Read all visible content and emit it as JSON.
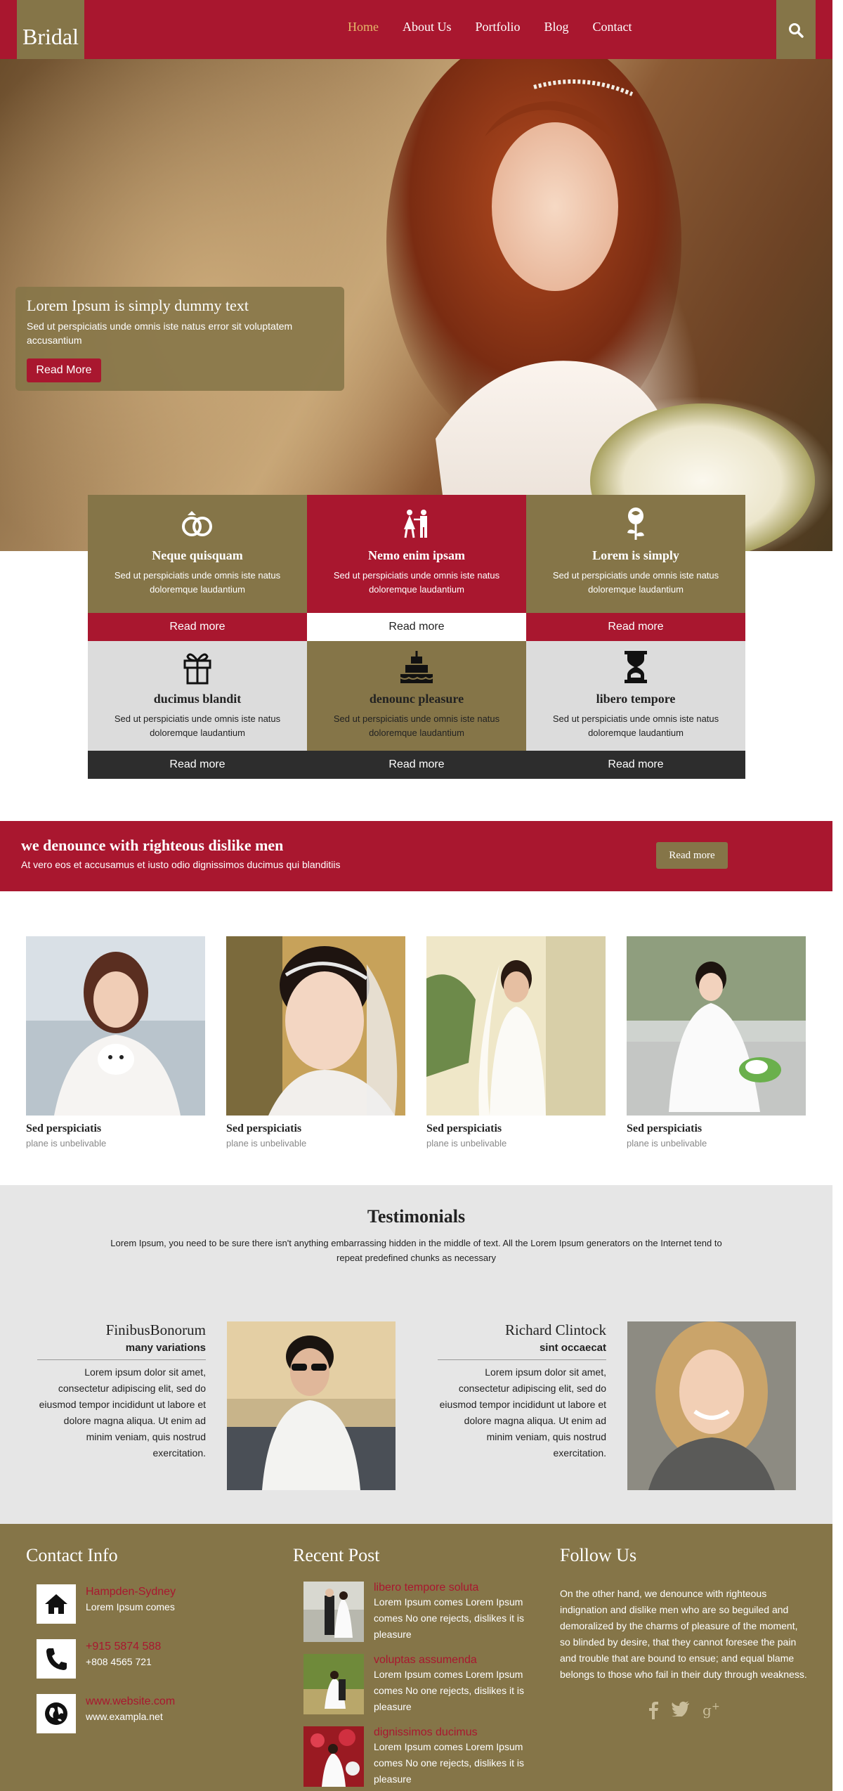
{
  "header": {
    "logo": "Bridal",
    "nav": [
      "Home",
      "About Us",
      "Portfolio",
      "Blog",
      "Contact"
    ],
    "active_nav": "Home"
  },
  "hero": {
    "title": "Lorem Ipsum is simply dummy text",
    "text": "Sed ut perspiciatis unde omnis iste natus error sit voluptatem accusantium",
    "button": "Read More"
  },
  "services": [
    {
      "icon": "rings-icon",
      "title": "Neque quisquam",
      "text": "Sed ut perspiciatis unde omnis iste natus doloremque laudantium",
      "more": "Read more"
    },
    {
      "icon": "bride-groom-icon",
      "title": "Nemo enim ipsam",
      "text": "Sed ut perspiciatis unde omnis iste natus doloremque laudantium",
      "more": "Read more"
    },
    {
      "icon": "rose-icon",
      "title": "Lorem is simply",
      "text": "Sed ut perspiciatis unde omnis iste natus doloremque laudantium",
      "more": "Read more"
    },
    {
      "icon": "gift-icon",
      "title": "ducimus blandit",
      "text": "Sed ut perspiciatis unde omnis iste natus doloremque laudantium",
      "more": "Read more"
    },
    {
      "icon": "cake-icon",
      "title": "denounc pleasure",
      "text": "Sed ut perspiciatis unde omnis iste natus doloremque laudantium",
      "more": "Read more"
    },
    {
      "icon": "hourglass-icon",
      "title": "libero tempore",
      "text": "Sed ut perspiciatis unde omnis iste natus doloremque laudantium",
      "more": "Read more"
    }
  ],
  "banner": {
    "title": "we denounce with righteous dislike men",
    "text": "At vero eos et accusamus et iusto odio dignissimos ducimus qui blanditiis",
    "button": "Read more"
  },
  "gallery": [
    {
      "title": "Sed perspiciatis",
      "subtitle": "plane is unbelivable"
    },
    {
      "title": "Sed perspiciatis",
      "subtitle": "plane is unbelivable"
    },
    {
      "title": "Sed perspiciatis",
      "subtitle": "plane is unbelivable"
    },
    {
      "title": "Sed perspiciatis",
      "subtitle": "plane is unbelivable"
    }
  ],
  "testimonials": {
    "title": "Testimonials",
    "intro": "Lorem Ipsum, you need to be sure there isn't anything embarrassing hidden in the middle of text. All the Lorem Ipsum generators on the Internet tend to repeat predefined chunks as necessary",
    "items": [
      {
        "name": "FinibusBonorum",
        "role": "many variations",
        "text": "Lorem ipsum dolor sit amet, consectetur adipiscing elit, sed do eiusmod tempor incididunt ut labore et dolore magna aliqua. Ut enim ad minim veniam, quis nostrud exercitation."
      },
      {
        "name": "Richard Clintock",
        "role": "sint occaecat",
        "text": "Lorem ipsum dolor sit amet, consectetur adipiscing elit, sed do eiusmod tempor incididunt ut labore et dolore magna aliqua. Ut enim ad minim veniam, quis nostrud exercitation."
      }
    ]
  },
  "footer": {
    "contact": {
      "title": "Contact Info",
      "items": [
        {
          "icon": "home-icon",
          "title": "Hampden-Sydney",
          "text": "Lorem Ipsum comes"
        },
        {
          "icon": "phone-icon",
          "title": "+915 5874 588",
          "text": "+808 4565 721"
        },
        {
          "icon": "globe-icon",
          "title": "www.website.com",
          "text": "www.exampla.net"
        }
      ]
    },
    "recent": {
      "title": "Recent Post",
      "items": [
        {
          "title": "libero tempore soluta",
          "text": "Lorem Ipsum comes Lorem Ipsum comes No one rejects, dislikes it is pleasure"
        },
        {
          "title": "voluptas assumenda",
          "text": "Lorem Ipsum comes Lorem Ipsum comes No one rejects, dislikes it is pleasure"
        },
        {
          "title": "dignissimos ducimus",
          "text": "Lorem Ipsum comes Lorem Ipsum comes No one rejects, dislikes it is pleasure"
        }
      ]
    },
    "follow": {
      "title": "Follow Us",
      "text": "On the other hand, we denounce with righteous indignation and dislike men who are so beguiled and demoralized by the charms of pleasure of the moment, so blinded by desire, that they cannot foresee the pain and trouble that are bound to ensue; and equal blame belongs to those who fail in their duty through weakness.",
      "social": [
        "facebook-icon",
        "twitter-icon",
        "google-plus-icon"
      ]
    }
  },
  "colors": {
    "primary": "#a9172f",
    "secondary": "#857548",
    "dark": "#2d2d2d",
    "light": "#dcdcdc"
  }
}
